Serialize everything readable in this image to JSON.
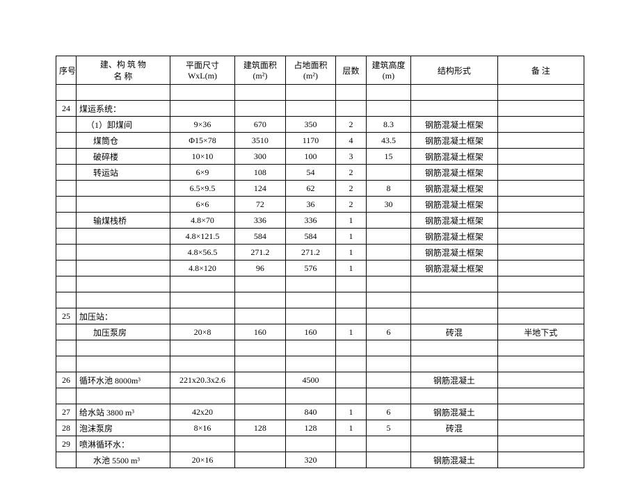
{
  "headers": {
    "seq": "序号",
    "name_l1": "建、构 筑 物",
    "name_l2": "名        称",
    "dim_l1": "平面尺寸",
    "dim_l2": "WxL(m)",
    "build_l1": "建筑面积",
    "build_l2": "(m²)",
    "land_l1": "占地面积",
    "land_l2": "(m²)",
    "floors": "层数",
    "height_l1": "建筑高度",
    "height_l2": "(m)",
    "struct": "结构形式",
    "remark": "备    注"
  },
  "rows": [
    {
      "seq": "",
      "name": "",
      "dim": "",
      "build": "",
      "land": "",
      "floors": "",
      "height": "",
      "struct": "",
      "remark": "",
      "nameClass": "name-cell"
    },
    {
      "seq": "24",
      "name": "煤运系统：",
      "dim": "",
      "build": "",
      "land": "",
      "floors": "",
      "height": "",
      "struct": "",
      "remark": "",
      "nameClass": "name-cell"
    },
    {
      "seq": "",
      "name": "（1）卸煤间",
      "dim": "9×36",
      "build": "670",
      "land": "350",
      "floors": "2",
      "height": "8.3",
      "struct": "钢筋混凝土框架",
      "remark": "",
      "nameClass": "name-cell indent1"
    },
    {
      "seq": "",
      "name": "煤筒仓",
      "dim": "Φ15×78",
      "build": "3510",
      "land": "1170",
      "floors": "4",
      "height": "43.5",
      "struct": "钢筋混凝土框架",
      "remark": "",
      "nameClass": "name-cell indent2"
    },
    {
      "seq": "",
      "name": "破碎楼",
      "dim": "10×10",
      "build": "300",
      "land": "100",
      "floors": "3",
      "height": "15",
      "struct": "钢筋混凝土框架",
      "remark": "",
      "nameClass": "name-cell indent2"
    },
    {
      "seq": "",
      "name": "转运站",
      "dim": "6×9",
      "build": "108",
      "land": "54",
      "floors": "2",
      "height": "",
      "struct": "钢筋混凝土框架",
      "remark": "",
      "nameClass": "name-cell indent2"
    },
    {
      "seq": "",
      "name": "",
      "dim": "6.5×9.5",
      "build": "124",
      "land": "62",
      "floors": "2",
      "height": "8",
      "struct": "钢筋混凝土框架",
      "remark": "",
      "nameClass": "name-cell"
    },
    {
      "seq": "",
      "name": "",
      "dim": "6×6",
      "build": "72",
      "land": "36",
      "floors": "2",
      "height": "30",
      "struct": "钢筋混凝土框架",
      "remark": "",
      "nameClass": "name-cell"
    },
    {
      "seq": "",
      "name": "输煤栈桥",
      "dim": "4.8×70",
      "build": "336",
      "land": "336",
      "floors": "1",
      "height": "",
      "struct": "钢筋混凝土框架",
      "remark": "",
      "nameClass": "name-cell indent2"
    },
    {
      "seq": "",
      "name": "",
      "dim": "4.8×121.5",
      "build": "584",
      "land": "584",
      "floors": "1",
      "height": "",
      "struct": "钢筋混凝土框架",
      "remark": "",
      "nameClass": "name-cell"
    },
    {
      "seq": "",
      "name": "",
      "dim": "4.8×56.5",
      "build": "271.2",
      "land": "271.2",
      "floors": "1",
      "height": "",
      "struct": "钢筋混凝土框架",
      "remark": "",
      "nameClass": "name-cell"
    },
    {
      "seq": "",
      "name": "",
      "dim": "4.8×120",
      "build": "96",
      "land": "576",
      "floors": "1",
      "height": "",
      "struct": "钢筋混凝土框架",
      "remark": "",
      "nameClass": "name-cell"
    },
    {
      "seq": "",
      "name": "",
      "dim": "",
      "build": "",
      "land": "",
      "floors": "",
      "height": "",
      "struct": "",
      "remark": "",
      "nameClass": "name-cell"
    },
    {
      "seq": "",
      "name": "",
      "dim": "",
      "build": "",
      "land": "",
      "floors": "",
      "height": "",
      "struct": "",
      "remark": "",
      "nameClass": "name-cell"
    },
    {
      "seq": "25",
      "name": "加压站：",
      "dim": "",
      "build": "",
      "land": "",
      "floors": "",
      "height": "",
      "struct": "",
      "remark": "",
      "nameClass": "name-cell"
    },
    {
      "seq": "",
      "name": "加压泵房",
      "dim": "20×8",
      "build": "160",
      "land": "160",
      "floors": "1",
      "height": "6",
      "struct": "砖混",
      "remark": "半地下式",
      "nameClass": "name-cell indent2"
    },
    {
      "seq": "",
      "name": "",
      "dim": "",
      "build": "",
      "land": "",
      "floors": "",
      "height": "",
      "struct": "",
      "remark": "",
      "nameClass": "name-cell"
    },
    {
      "seq": "",
      "name": "",
      "dim": "",
      "build": "",
      "land": "",
      "floors": "",
      "height": "",
      "struct": "",
      "remark": "",
      "nameClass": "name-cell"
    },
    {
      "seq": "26",
      "name": "循环水池 8000m³",
      "dim": "221x20.3x2.6",
      "build": "",
      "land": "4500",
      "floors": "",
      "height": "",
      "struct": "钢筋混凝土",
      "remark": "",
      "nameClass": "name-cell"
    },
    {
      "seq": "",
      "name": "",
      "dim": "",
      "build": "",
      "land": "",
      "floors": "",
      "height": "",
      "struct": "",
      "remark": "",
      "nameClass": "name-cell"
    },
    {
      "seq": "27",
      "name": "给水站 3800 m³",
      "dim": "42x20",
      "build": "",
      "land": "840",
      "floors": "1",
      "height": "6",
      "struct": "钢筋混凝土",
      "remark": "",
      "nameClass": "name-cell"
    },
    {
      "seq": "28",
      "name": "泡沫泵房",
      "dim": "8×16",
      "build": "128",
      "land": "128",
      "floors": "1",
      "height": "5",
      "struct": "砖混",
      "remark": "",
      "nameClass": "name-cell"
    },
    {
      "seq": "29",
      "name": "喷淋循环水：",
      "dim": "",
      "build": "",
      "land": "",
      "floors": "",
      "height": "",
      "struct": "",
      "remark": "",
      "nameClass": "name-cell"
    },
    {
      "seq": "",
      "name": "水池 5500 m³",
      "dim": "20×16",
      "build": "",
      "land": "320",
      "floors": "",
      "height": "",
      "struct": "钢筋混凝土",
      "remark": "",
      "nameClass": "name-cell indent2"
    }
  ]
}
